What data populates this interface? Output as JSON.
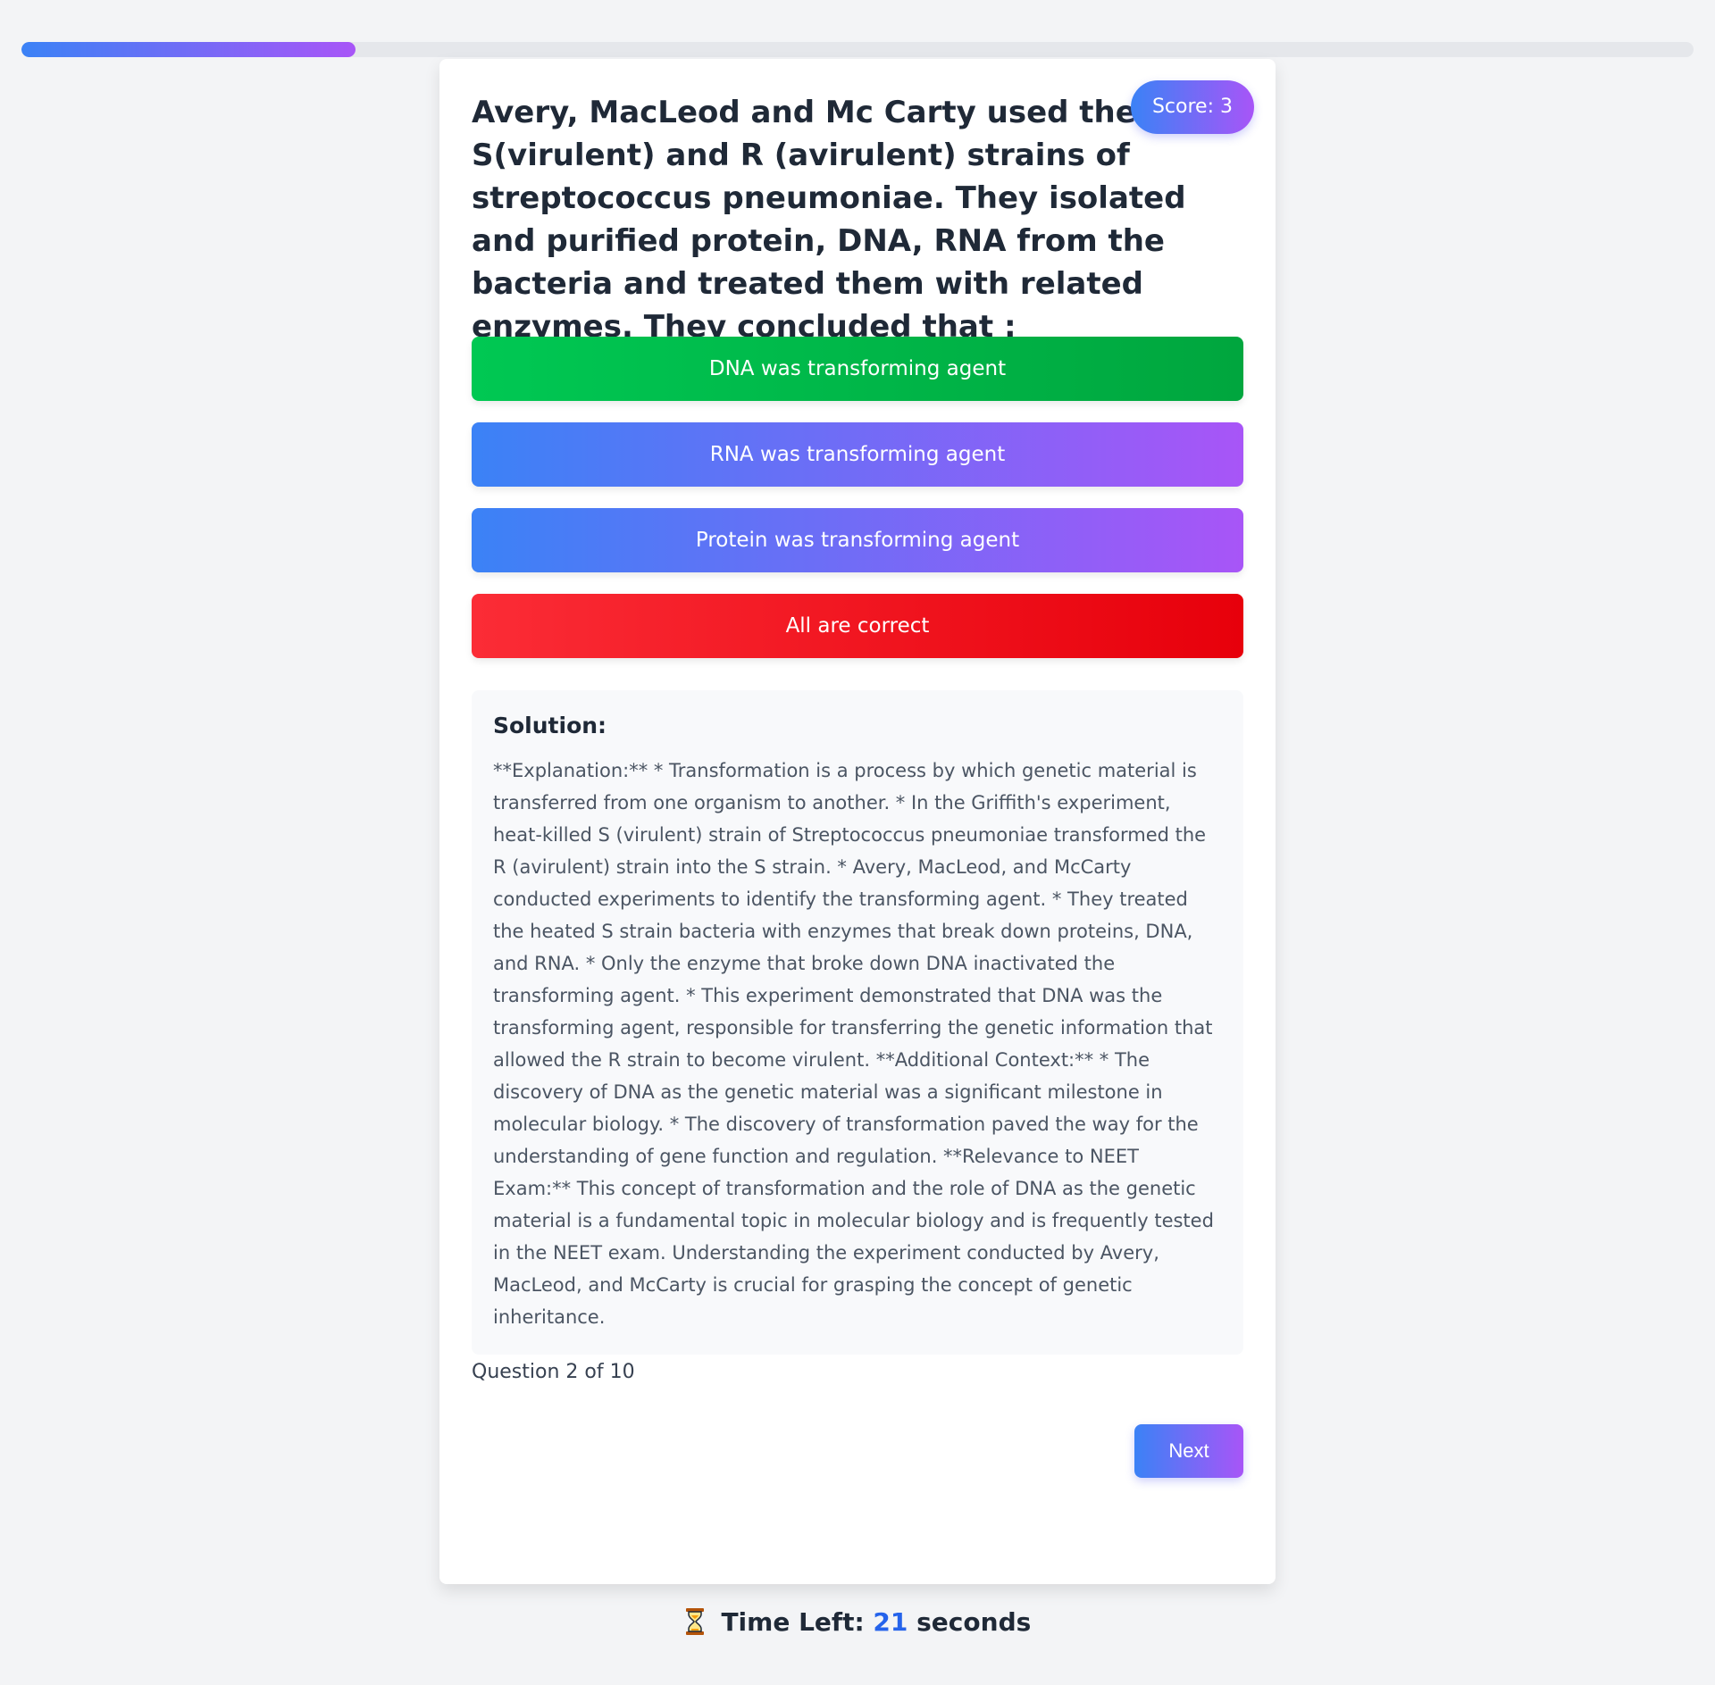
{
  "progress": {
    "value_fraction": 0.2
  },
  "score": {
    "label": "Score: 3"
  },
  "question": {
    "text": "Avery, MacLeod and Mc Carty used the S(virulent) and R (avirulent) strains of streptococcus pneumoniae. They isolated and purified protein, DNA, RNA from the bacteria and treated them with related enzymes. They concluded that :"
  },
  "options": [
    {
      "label": "DNA was transforming agent",
      "state": "correct"
    },
    {
      "label": "RNA was transforming agent",
      "state": "neutral"
    },
    {
      "label": "Protein was transforming agent",
      "state": "neutral"
    },
    {
      "label": "All are correct",
      "state": "wrong"
    }
  ],
  "solution": {
    "title": "Solution:",
    "text": "**Explanation:** * Transformation is a process by which genetic material is transferred from one organism to another. * In the Griffith's experiment, heat-killed S (virulent) strain of Streptococcus pneumoniae transformed the R (avirulent) strain into the S strain. * Avery, MacLeod, and McCarty conducted experiments to identify the transforming agent. * They treated the heated S strain bacteria with enzymes that break down proteins, DNA, and RNA. * Only the enzyme that broke down DNA inactivated the transforming agent. * This experiment demonstrated that DNA was the transforming agent, responsible for transferring the genetic information that allowed the R strain to become virulent. **Additional Context:** * The discovery of DNA as the genetic material was a significant milestone in molecular biology. * The discovery of transformation paved the way for the understanding of gene function and regulation. **Relevance to NEET Exam:** This concept of transformation and the role of DNA as the genetic material is a fundamental topic in molecular biology and is frequently tested in the NEET exam. Understanding the experiment conducted by Avery, MacLeod, and McCarty is crucial for grasping the concept of genetic inheritance."
  },
  "footer": {
    "question_counter": "Question 2 of 10",
    "next_label": "Next"
  },
  "timer": {
    "prefix": "Time Left:",
    "value": "21",
    "suffix": "seconds"
  },
  "colors": {
    "accent_start": "#3b82f6",
    "accent_end": "#a855f7",
    "correct": "#00c853",
    "wrong": "#e7000b",
    "timer_value": "#2563eb"
  }
}
